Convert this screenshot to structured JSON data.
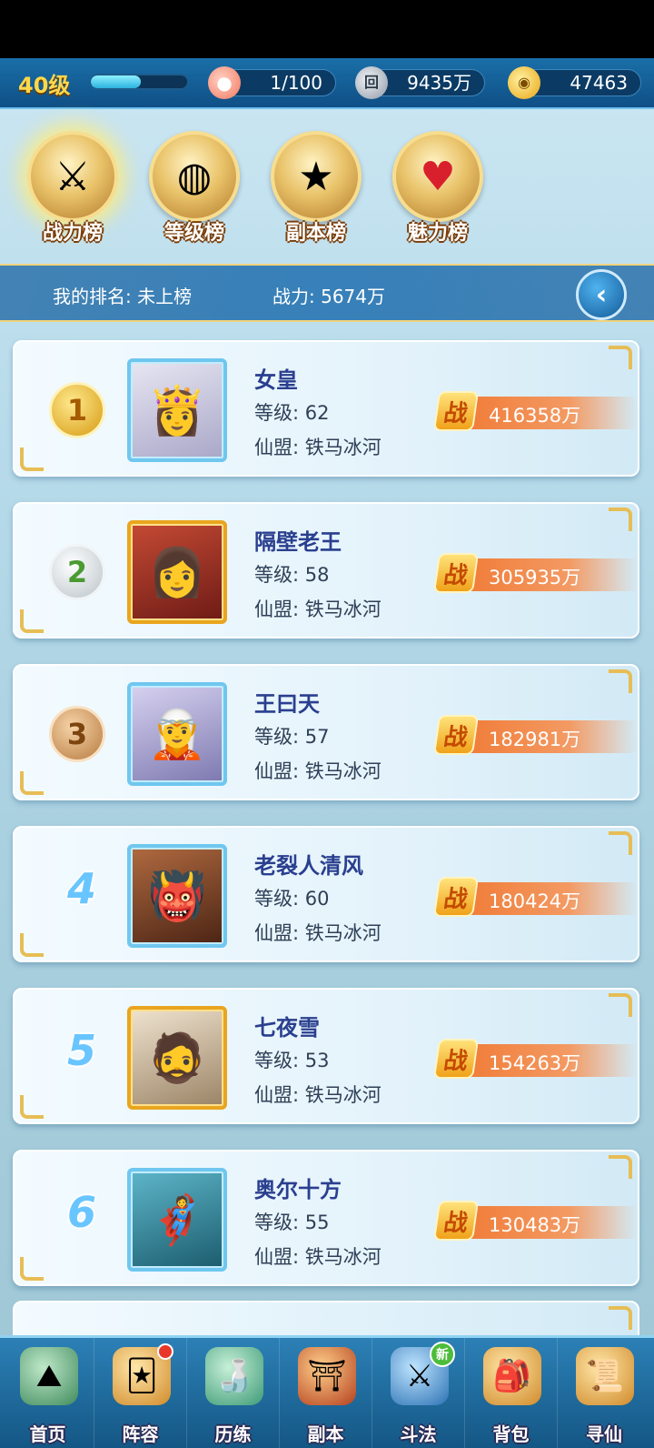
{
  "topbar": {
    "level": "40级",
    "xp_progress": 0.52,
    "stamina": "1/100",
    "silver": "9435万",
    "gold": "47463",
    "coin_icon_glyph": "回",
    "ingot_icon_glyph": "◉"
  },
  "tabs": [
    {
      "label": "战力榜",
      "icon": "sword-medal-icon",
      "active": true
    },
    {
      "label": "等级榜",
      "icon": "drum-medal-icon",
      "active": false
    },
    {
      "label": "副本榜",
      "icon": "star-medal-icon",
      "active": false
    },
    {
      "label": "魅力榜",
      "icon": "heart-medal-icon",
      "active": false
    }
  ],
  "my_rank": {
    "rank_text": "我的排名: 未上榜",
    "power_text": "战力: 5674万"
  },
  "power_badge_char": "战",
  "rankings": [
    {
      "rank": "1",
      "name": "女皇",
      "level": "等级: 62",
      "guild": "仙盟: 铁马冰河",
      "power": "416358万"
    },
    {
      "rank": "2",
      "name": "隔壁老王",
      "level": "等级: 58",
      "guild": "仙盟: 铁马冰河",
      "power": "305935万"
    },
    {
      "rank": "3",
      "name": "王曰天",
      "level": "等级: 57",
      "guild": "仙盟: 铁马冰河",
      "power": "182981万"
    },
    {
      "rank": "4",
      "name": "老裂人清风",
      "level": "等级: 60",
      "guild": "仙盟: 铁马冰河",
      "power": "180424万"
    },
    {
      "rank": "5",
      "name": "七夜雪",
      "level": "等级: 53",
      "guild": "仙盟: 铁马冰河",
      "power": "154263万"
    },
    {
      "rank": "6",
      "name": "奥尔十方",
      "level": "等级: 55",
      "guild": "仙盟: 铁马冰河",
      "power": "130483万"
    }
  ],
  "bottom_nav": [
    {
      "label": "首页",
      "icon": "home-icon"
    },
    {
      "label": "阵容",
      "icon": "lineup-icon"
    },
    {
      "label": "历练",
      "icon": "training-icon"
    },
    {
      "label": "副本",
      "icon": "dungeon-icon"
    },
    {
      "label": "斗法",
      "icon": "battle-icon",
      "badge": "新"
    },
    {
      "label": "背包",
      "icon": "bag-icon"
    },
    {
      "label": "寻仙",
      "icon": "scroll-icon"
    }
  ],
  "colors": {
    "topbar": "#1a6fa8",
    "power_bar": "#f0752e",
    "name": "#2a3f8f",
    "level_gold": "#ffd84a"
  }
}
